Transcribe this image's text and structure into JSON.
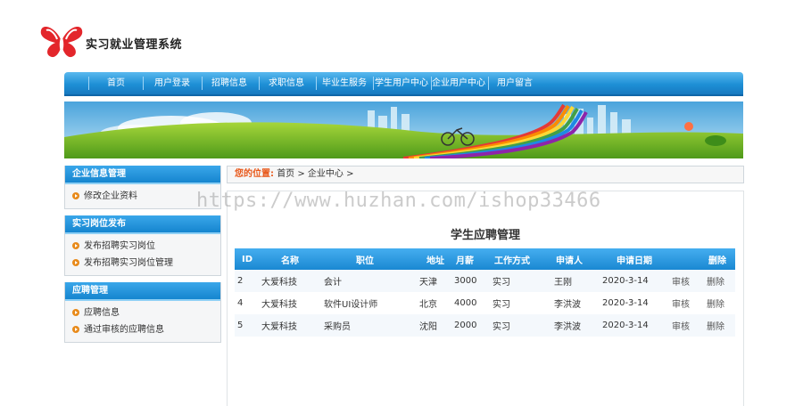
{
  "site": {
    "title": "实习就业管理系统"
  },
  "nav": [
    "首页",
    "用户登录",
    "招聘信息",
    "求职信息",
    "毕业生服务",
    "学生用户中心",
    "企业用户中心",
    "用户留言"
  ],
  "sidebar": [
    {
      "header": "企业信息管理",
      "links": [
        "修改企业资料"
      ]
    },
    {
      "header": "实习岗位发布",
      "links": [
        "发布招聘实习岗位",
        "发布招聘实习岗位管理"
      ]
    },
    {
      "header": "应聘管理",
      "links": [
        "应聘信息",
        "通过审核的应聘信息"
      ]
    }
  ],
  "breadcrumb": {
    "label": "您的位置:",
    "path": "首页 > 企业中心 >"
  },
  "watermark": "https://www.huzhan.com/ishop33466",
  "main": {
    "title": "学生应聘管理",
    "columns": [
      "ID",
      "名称",
      "职位",
      "地址",
      "月薪",
      "工作方式",
      "申请人",
      "申请日期",
      "",
      "删除"
    ],
    "rows": [
      [
        "2",
        "大爱科技",
        "会计",
        "天津",
        "3000",
        "实习",
        "王刚",
        "2020-3-14",
        "审核",
        "删除"
      ],
      [
        "4",
        "大爱科技",
        "软件UI设计师",
        "北京",
        "4000",
        "实习",
        "李洪波",
        "2020-3-14",
        "审核",
        "删除"
      ],
      [
        "5",
        "大爱科技",
        "采购员",
        "沈阳",
        "2000",
        "实习",
        "李洪波",
        "2020-3-14",
        "审核",
        "删除"
      ]
    ]
  },
  "colors": {
    "nav_blue": "#1e8fd6",
    "accent_orange": "#e8581a",
    "bullet_orange": "#e88a1a"
  }
}
